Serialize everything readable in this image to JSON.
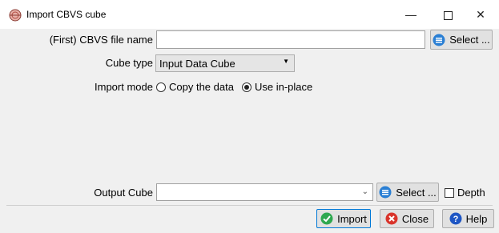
{
  "window": {
    "title": "Import CBVS cube",
    "minimize_glyph": "—",
    "close_glyph": "✕"
  },
  "form": {
    "file_label": "(First) CBVS file name",
    "file_value": "",
    "file_select_label": "Select ...",
    "cube_type_label": "Cube type",
    "cube_type_value": "Input Data Cube",
    "import_mode_label": "Import mode",
    "mode_copy": "Copy the data",
    "mode_inplace": "Use in-place",
    "selected_mode": "Use in-place",
    "output_label": "Output Cube",
    "output_value": "",
    "output_select_label": "Select ...",
    "depth_label": "Depth",
    "depth_checked": false
  },
  "buttons": {
    "import_label": "Import",
    "close_label": "Close",
    "help_label": "Help"
  },
  "colors": {
    "select_icon": "#2a7fd4",
    "import_icon": "#2fa84f",
    "close_icon": "#d9342b",
    "help_icon": "#1e56c4"
  }
}
